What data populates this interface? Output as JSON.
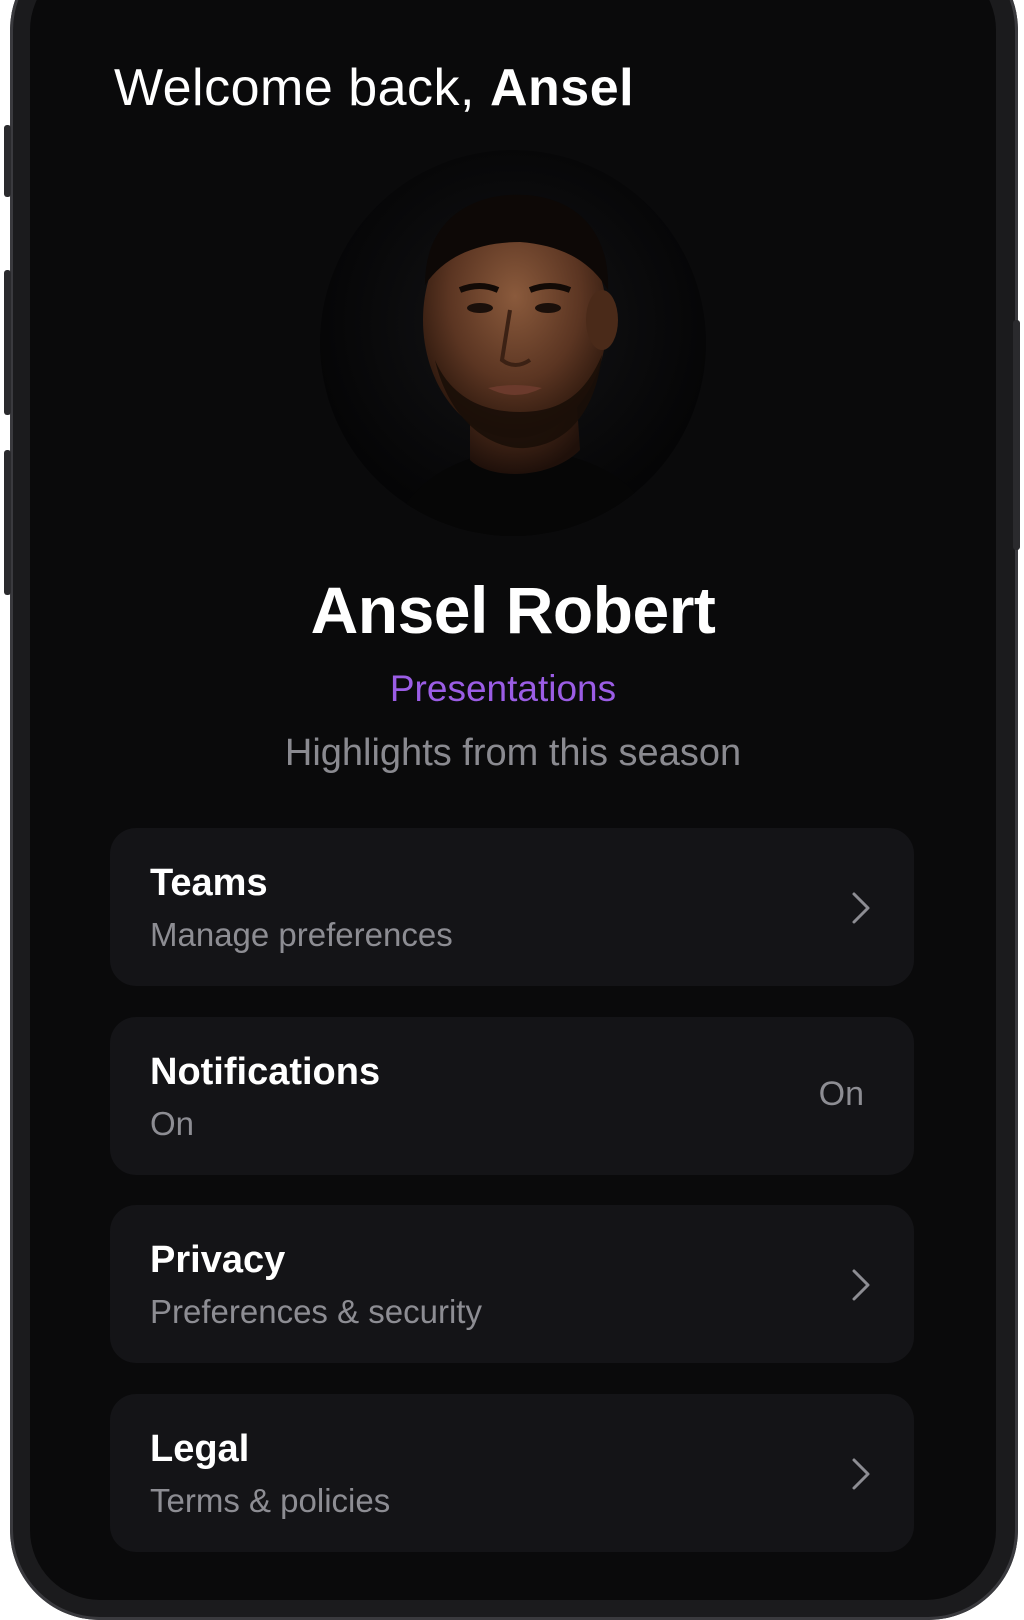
{
  "header": {
    "welcome_prefix": "Welcome back,",
    "welcome_name": "Ansel"
  },
  "profile": {
    "avatar_icon": "user-portrait",
    "name": "Ansel Robert",
    "role": "Presentations",
    "subtitle": "Highlights from this season"
  },
  "settings": {
    "items": [
      {
        "title": "Teams",
        "subtitle": "Manage preferences",
        "icon": "chevron-right-icon"
      },
      {
        "title": "Notifications",
        "subtitle": "On",
        "value": "On"
      },
      {
        "title": "Privacy",
        "subtitle": "Preferences & security",
        "icon": "chevron-right-icon"
      },
      {
        "title": "Legal",
        "subtitle": "Terms & policies",
        "icon": "chevron-right-icon"
      }
    ]
  },
  "colors": {
    "background": "#0a0a0b",
    "card": "#141417",
    "accent": "#9b5de5",
    "muted_text": "#8d8d93"
  }
}
